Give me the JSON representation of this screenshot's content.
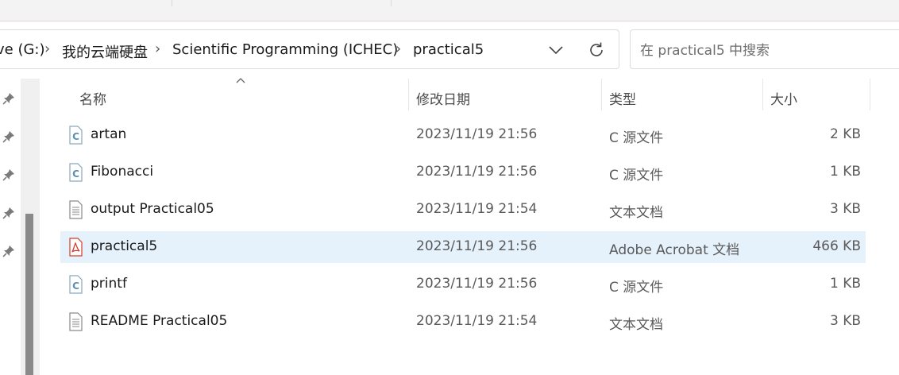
{
  "breadcrumbs": [
    "ve (G:)",
    "我的云端硬盘",
    "Scientific Programming (ICHEC)",
    "practical5"
  ],
  "search": {
    "placeholder": "在 practical5 中搜索"
  },
  "columns": {
    "name": "名称",
    "date": "修改日期",
    "type": "类型",
    "size": "大小"
  },
  "files": [
    {
      "name": "artan",
      "date": "2023/11/19 21:56",
      "type": "C 源文件",
      "size": "2 KB",
      "icon": "c-file-icon",
      "selected": false
    },
    {
      "name": "Fibonacci",
      "date": "2023/11/19 21:56",
      "type": "C 源文件",
      "size": "1 KB",
      "icon": "c-file-icon",
      "selected": false
    },
    {
      "name": "output Practical05",
      "date": "2023/11/19 21:54",
      "type": "文本文档",
      "size": "3 KB",
      "icon": "text-file-icon",
      "selected": false
    },
    {
      "name": "practical5",
      "date": "2023/11/19 21:56",
      "type": "Adobe Acrobat 文档",
      "size": "466 KB",
      "icon": "pdf-file-icon",
      "selected": true
    },
    {
      "name": "printf",
      "date": "2023/11/19 21:56",
      "type": "C 源文件",
      "size": "1 KB",
      "icon": "c-file-icon",
      "selected": false
    },
    {
      "name": "README Practical05",
      "date": "2023/11/19 21:54",
      "type": "文本文档",
      "size": "3 KB",
      "icon": "text-file-icon",
      "selected": false
    }
  ],
  "colors": {
    "selected_row": "#e5f1fb",
    "pdf_red": "#d83b2b",
    "c_icon_blue": "#5a8fb0"
  }
}
